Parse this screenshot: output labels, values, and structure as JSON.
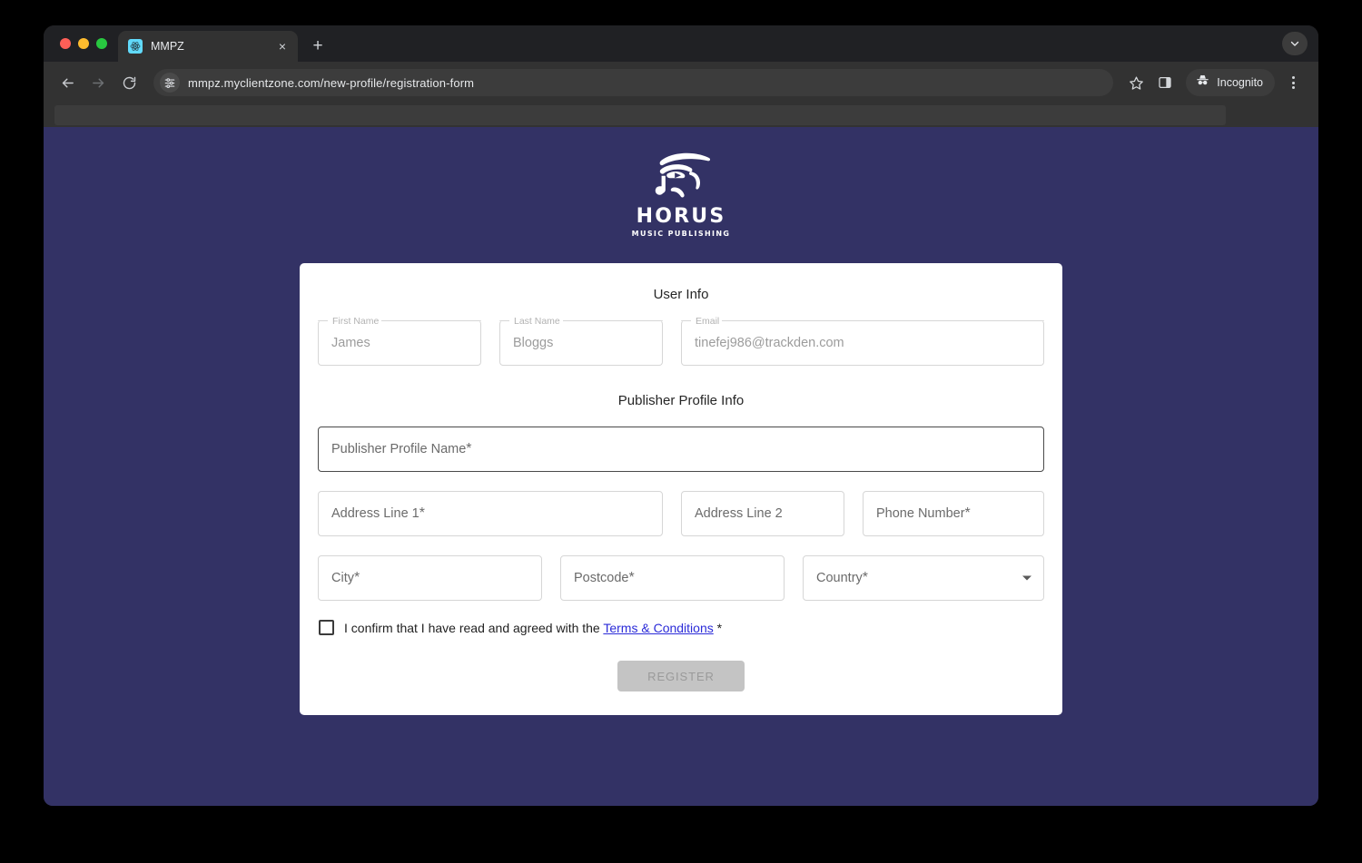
{
  "browser": {
    "tab": {
      "title": "MMPZ",
      "favicon": "react-atom-icon",
      "close": "×"
    },
    "new_tab": "+",
    "tabstrip_chevron": "⌄",
    "nav": {
      "back": "←",
      "forward": "→",
      "reload": "⟳"
    },
    "omnibox": {
      "url": "mmpz.myclientzone.com/new-profile/registration-form",
      "site_settings_icon": "tune-sliders-icon"
    },
    "actions": {
      "bookmark_icon": "star-icon",
      "side_panel_icon": "side-panel-icon",
      "incognito_label": "Incognito",
      "incognito_icon": "incognito-hat-icon",
      "menu_icon": "kebab-menu-icon"
    }
  },
  "page": {
    "background_color": "#333265",
    "logo": {
      "mark": "eye-of-horus-music-note-icon",
      "wordmark": "HORUS",
      "tagline": "MUSIC PUBLISHING"
    },
    "sections": {
      "user_info_title": "User Info",
      "publisher_info_title": "Publisher Profile Info"
    },
    "user_info": [
      {
        "name": "first-name",
        "label": "First Name",
        "value": "James"
      },
      {
        "name": "last-name",
        "label": "Last Name",
        "value": "Bloggs"
      },
      {
        "name": "email",
        "label": "Email",
        "value": "tinefej986@trackden.com"
      }
    ],
    "publisher_info": {
      "profile_name": {
        "placeholder": "Publisher Profile Name",
        "required": "*"
      },
      "address_line_1": {
        "placeholder": "Address Line 1",
        "required": "*"
      },
      "address_line_2": {
        "placeholder": "Address Line 2",
        "required": ""
      },
      "phone_number": {
        "placeholder": "Phone Number",
        "required": "*"
      },
      "city": {
        "placeholder": "City",
        "required": "*"
      },
      "postcode": {
        "placeholder": "Postcode",
        "required": "*"
      },
      "country": {
        "placeholder": "Country",
        "required": "*",
        "arrow": "chevron-down-icon"
      }
    },
    "terms": {
      "prefix": "I confirm that I have read and agreed with the ",
      "link": "Terms & Conditions",
      "required": " *"
    },
    "submit": {
      "label": "REGISTER",
      "state": "disabled"
    }
  },
  "colors": {
    "page_bg": "#333265",
    "card_bg": "#ffffff",
    "link": "#2b2bd8",
    "disabled_button_bg": "#c4c4c4",
    "disabled_button_text": "#9a9a9a"
  }
}
